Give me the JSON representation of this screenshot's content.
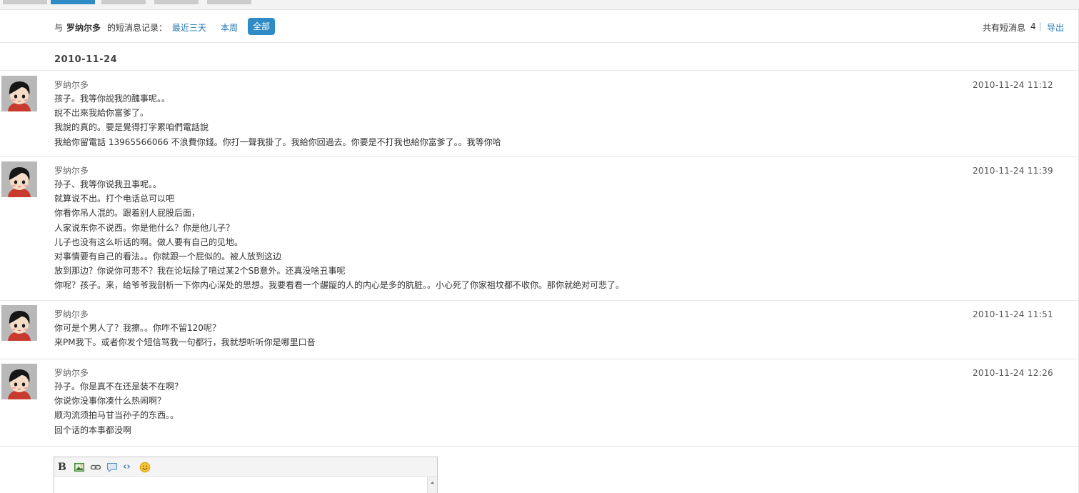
{
  "filter": {
    "prefix": "与",
    "contact_name": "罗纳尔多",
    "suffix": "的短消息记录：",
    "options": [
      "最近三天",
      "本周",
      "全部"
    ],
    "total_label": "共有短消息",
    "total_count": "4",
    "export_label": "导出"
  },
  "date_group": "2010-11-24",
  "messages": [
    {
      "sender": "罗纳尔多",
      "time": "2010-11-24 11:12",
      "lines": [
        "孩子。我等你說我的醜事呢。。",
        "說不出來我給你富爹了。",
        "我說的真的。要是覺得打字累咱們電話說",
        "我給你留電話 13965566066 不浪費你錢。你打一聲我掛了。我給你回過去。你要是不打我也給你富爹了。。我等你哈"
      ]
    },
    {
      "sender": "罗纳尔多",
      "time": "2010-11-24 11:39",
      "lines": [
        "孙子、我等你说我丑事呢。。",
        "就算说不出。打个电话总可以吧",
        "你看你吊人混的。跟着别人屁股后面，",
        "人家说东你不说西。你是他什么？你是他儿子？",
        "儿子也没有这么听话的啊。做人要有自己的见地。",
        "对事情要有自己的看法。。你就跟一个屁似的。被人放到这边",
        "放到那边？你说你可悲不？我在论坛除了喷过某2个SB意外。还真没啥丑事呢",
        "你呢？孩子。来，给爷爷我剖析一下你内心深处的思想。我要看看一个龌龊的人的内心是多的肮脏。。小心死了你家祖坟都不收你。那你就绝对可悲了。"
      ]
    },
    {
      "sender": "罗纳尔多",
      "time": "2010-11-24 11:51",
      "lines": [
        "你可是个男人了？我擦。。你咋不留120呢？",
        "来PM我下。或者你发个短信骂我一句都行，我就想听听你是哪里口音"
      ]
    },
    {
      "sender": "罗纳尔多",
      "time": "2010-11-24 12:26",
      "lines": [
        "孙子。你是真不在还是装不在啊？",
        "你说你没事你凑什么热闹啊？",
        "顺沟流须拍马甘当孙子的东西。。",
        "回个话的本事都没啊"
      ]
    }
  ],
  "editor": {
    "toolbar_icons": [
      "bold-icon",
      "image-icon",
      "link-icon",
      "quote-icon",
      "code-icon",
      "smiley-icon"
    ],
    "bold_glyph": "B",
    "code_glyph": "‹›"
  },
  "colors": {
    "accent": "#2f8bc6",
    "link": "#2479b4"
  }
}
